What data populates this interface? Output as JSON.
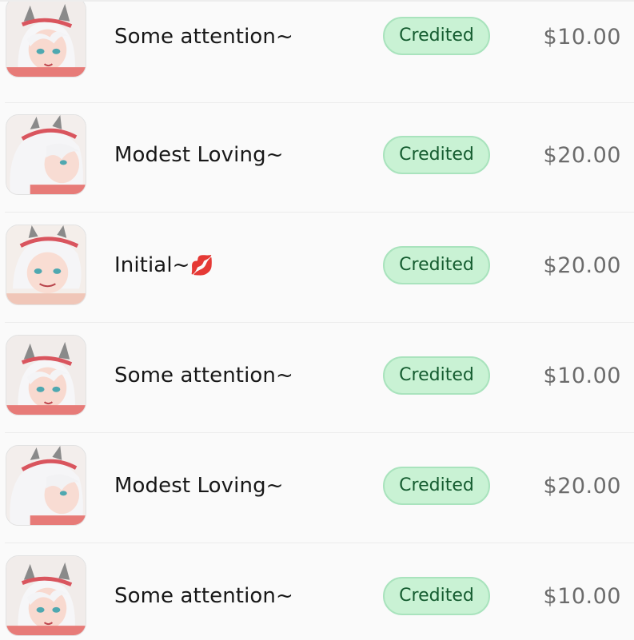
{
  "transactions": [
    {
      "title": "Some attention~",
      "emoji": "",
      "status": "Credited",
      "amount": "$10.00",
      "avatar_icon": "anime-girl-avatar-icon"
    },
    {
      "title": "Modest Loving~",
      "emoji": "",
      "status": "Credited",
      "amount": "$20.00",
      "avatar_icon": "anime-girl-avatar-icon"
    },
    {
      "title": "Initial~",
      "emoji": "💋",
      "status": "Credited",
      "amount": "$20.00",
      "avatar_icon": "anime-girl-avatar-icon"
    },
    {
      "title": "Some attention~",
      "emoji": "",
      "status": "Credited",
      "amount": "$10.00",
      "avatar_icon": "anime-girl-avatar-icon"
    },
    {
      "title": "Modest Loving~",
      "emoji": "",
      "status": "Credited",
      "amount": "$20.00",
      "avatar_icon": "anime-girl-avatar-icon"
    },
    {
      "title": "Some attention~",
      "emoji": "",
      "status": "Credited",
      "amount": "$10.00",
      "avatar_icon": "anime-girl-avatar-icon"
    }
  ],
  "colors": {
    "badge_bg": "#c9f2d4",
    "badge_border": "#a9e3bd",
    "badge_text": "#155c30",
    "amount_text": "#6b6b6b",
    "title_text": "#171717"
  }
}
